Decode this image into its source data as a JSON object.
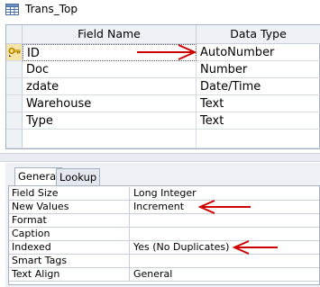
{
  "window": {
    "title": "Trans_Top",
    "icon": "table-icon"
  },
  "design_grid": {
    "columns": [
      "Field Name",
      "Data Type"
    ],
    "rows": [
      {
        "field": "ID",
        "type": "AutoNumber",
        "primary_key": true
      },
      {
        "field": "Doc",
        "type": "Number"
      },
      {
        "field": "zdate",
        "type": "Date/Time"
      },
      {
        "field": "Warehouse",
        "type": "Text"
      },
      {
        "field": "Type",
        "type": "Text"
      }
    ]
  },
  "properties": {
    "tabs": [
      "General",
      "Lookup"
    ],
    "active_tab": "General",
    "rows": [
      {
        "label": "Field Size",
        "value": "Long Integer"
      },
      {
        "label": "New Values",
        "value": "Increment"
      },
      {
        "label": "Format",
        "value": ""
      },
      {
        "label": "Caption",
        "value": ""
      },
      {
        "label": "Indexed",
        "value": "Yes (No Duplicates)"
      },
      {
        "label": "Smart Tags",
        "value": ""
      },
      {
        "label": "Text Align",
        "value": "General"
      }
    ]
  },
  "annotations": {
    "arrow_color": "#cc0000"
  },
  "colors": {
    "grid_border": "#a6b3c5",
    "header_bg": "#eef1f6",
    "key_gold": "#e8b400"
  }
}
